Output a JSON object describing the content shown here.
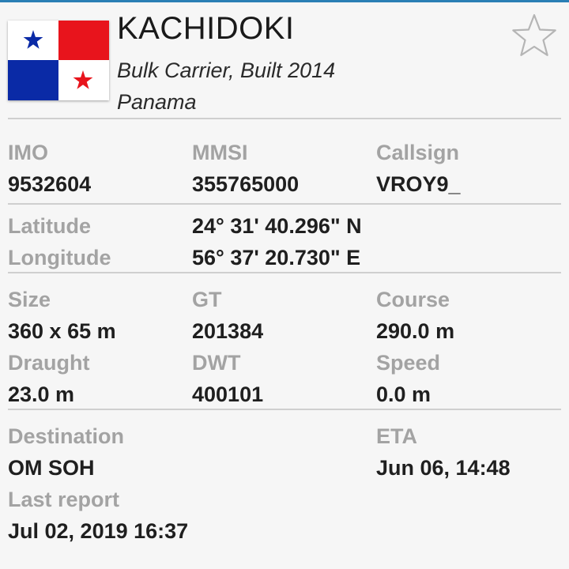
{
  "vessel": {
    "name": "KACHIDOKI",
    "type_built": "Bulk Carrier, Built 2014",
    "flag_country": "Panama",
    "flag_icon": "panama-flag-icon",
    "favorite_icon": "star-outline-icon"
  },
  "ids": {
    "imo_label": "IMO",
    "imo_value": "9532604",
    "mmsi_label": "MMSI",
    "mmsi_value": "355765000",
    "callsign_label": "Callsign",
    "callsign_value": "VROY9_"
  },
  "position": {
    "latitude_label": "Latitude",
    "latitude_value": "24° 31' 40.296\" N",
    "longitude_label": "Longitude",
    "longitude_value": "56° 37' 20.730\" E"
  },
  "dimensions": {
    "size_label": "Size",
    "size_value": "360 x 65 m",
    "gt_label": "GT",
    "gt_value": "201384",
    "course_label": "Course",
    "course_value": "290.0 m",
    "draught_label": "Draught",
    "draught_value": "23.0 m",
    "dwt_label": "DWT",
    "dwt_value": "400101",
    "speed_label": "Speed",
    "speed_value": "0.0 m"
  },
  "voyage": {
    "destination_label": "Destination",
    "destination_value": "OM SOH",
    "eta_label": "ETA",
    "eta_value": "Jun 06, 14:48",
    "last_report_label": "Last report",
    "last_report_value": "Jul 02, 2019 16:37"
  },
  "colors": {
    "flag_red": "#e8141c",
    "flag_blue": "#0a2aa6",
    "label_gray": "#a3a3a3",
    "value_dark": "#1f1f1f",
    "divider": "#cfcfcf"
  }
}
